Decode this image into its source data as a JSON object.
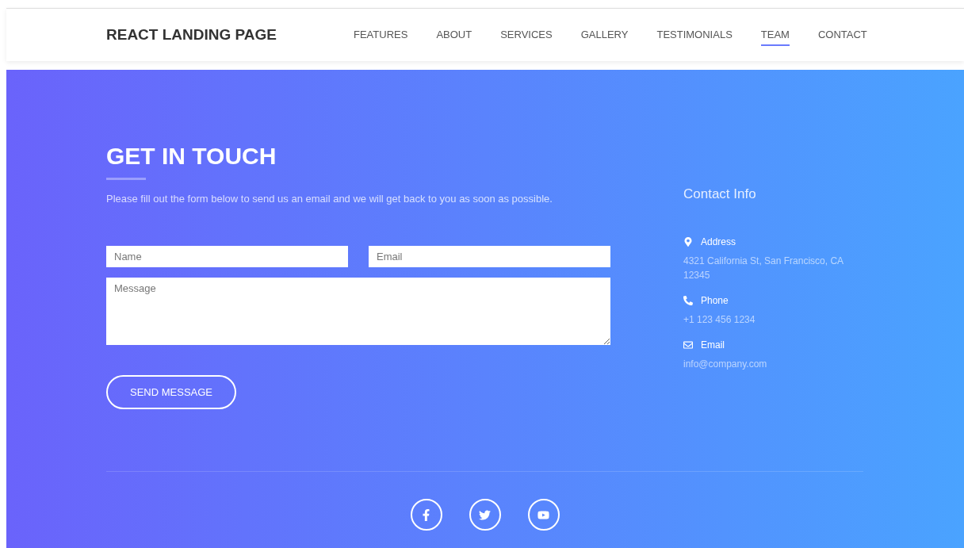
{
  "brand": "REACT LANDING PAGE",
  "nav": [
    {
      "label": "FEATURES",
      "selected": false
    },
    {
      "label": "ABOUT",
      "selected": false
    },
    {
      "label": "SERVICES",
      "selected": false
    },
    {
      "label": "GALLERY",
      "selected": false
    },
    {
      "label": "TESTIMONIALS",
      "selected": false
    },
    {
      "label": "TEAM",
      "selected": true
    },
    {
      "label": "CONTACT",
      "selected": false
    }
  ],
  "contact": {
    "title": "GET IN TOUCH",
    "intro": "Please fill out the form below to send us an email and we will get back to you as soon as possible.",
    "form": {
      "name_placeholder": "Name",
      "email_placeholder": "Email",
      "message_placeholder": "Message",
      "submit": "SEND MESSAGE"
    }
  },
  "contact_info": {
    "title": "Contact Info",
    "items": [
      {
        "kind": "address",
        "label": "Address",
        "value": "4321 California St, San Francisco, CA 12345"
      },
      {
        "kind": "phone",
        "label": "Phone",
        "value": "+1 123 456 1234"
      },
      {
        "kind": "email",
        "label": "Email",
        "value": "info@company.com"
      }
    ]
  },
  "social": [
    {
      "kind": "facebook"
    },
    {
      "kind": "twitter"
    },
    {
      "kind": "youtube"
    }
  ]
}
